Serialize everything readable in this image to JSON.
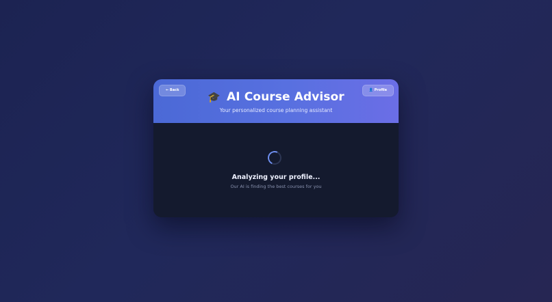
{
  "header": {
    "back_label": "← Back",
    "profile_label": "👤 Profile",
    "title_icon": "🎓",
    "title_icon_name": "graduation-cap-icon",
    "title": "AI Course Advisor",
    "subtitle": "Your personalized course planning assistant"
  },
  "loading": {
    "title": "Analyzing your profile...",
    "subtitle": "Our AI is finding the best courses for you"
  },
  "colors": {
    "header_gradient_start": "#4b69d6",
    "header_gradient_end": "#6b6ee6",
    "card_body": "#141a2e",
    "spinner_accent": "#6f8ff0"
  }
}
